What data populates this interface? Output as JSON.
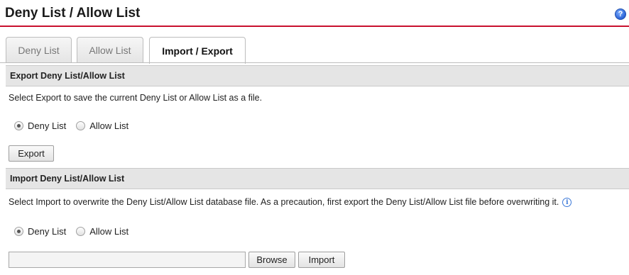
{
  "header": {
    "title": "Deny List / Allow List",
    "help_icon": "question-mark-icon",
    "help_glyph": "?"
  },
  "tabs": [
    {
      "label": "Deny List",
      "active": false
    },
    {
      "label": "Allow List",
      "active": false
    },
    {
      "label": "Import / Export",
      "active": true
    }
  ],
  "export_section": {
    "heading": "Export Deny List/Allow List",
    "description": "Select Export to save the current Deny List or Allow List as a file.",
    "options": [
      {
        "label": "Deny List",
        "selected": true
      },
      {
        "label": "Allow List",
        "selected": false
      }
    ],
    "export_label": "Export"
  },
  "import_section": {
    "heading": "Import Deny List/Allow List",
    "description": "Select Import to overwrite the Deny List/Allow List database file. As a precaution, first export the Deny List/Allow List file before overwriting it.",
    "info_icon": "info-icon",
    "info_glyph": "i",
    "options": [
      {
        "label": "Deny List",
        "selected": true
      },
      {
        "label": "Allow List",
        "selected": false
      }
    ],
    "file_value": "",
    "browse_label": "Browse",
    "import_label": "Import"
  },
  "colors": {
    "accent_line": "#c8102e",
    "section_bg": "#e5e5e5"
  }
}
